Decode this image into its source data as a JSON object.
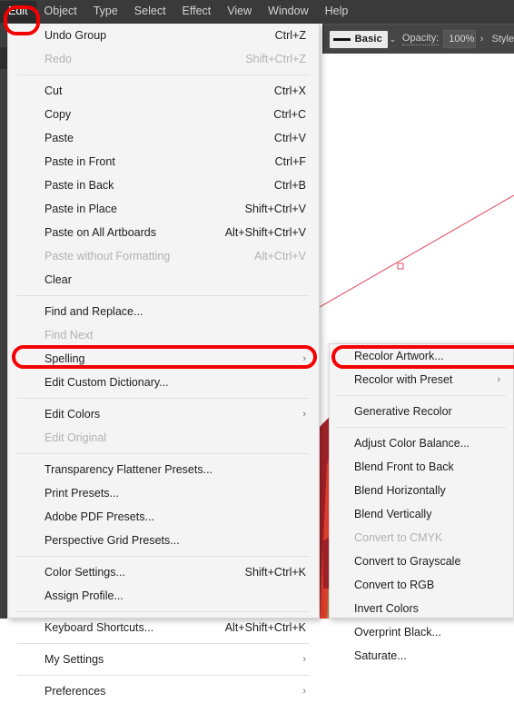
{
  "app": {
    "name": "Adobe Illustrator"
  },
  "menubar": {
    "items": [
      {
        "label": "Edit",
        "active": true
      },
      {
        "label": "Object",
        "active": false
      },
      {
        "label": "Type",
        "active": false
      },
      {
        "label": "Select",
        "active": false
      },
      {
        "label": "Effect",
        "active": false
      },
      {
        "label": "View",
        "active": false
      },
      {
        "label": "Window",
        "active": false
      },
      {
        "label": "Help",
        "active": false
      }
    ]
  },
  "control_bar": {
    "stroke_profile_label": "Basic",
    "opacity_label": "Opacity:",
    "opacity_value": "100%",
    "style_label": "Style",
    "caret_glyph": "⌄",
    "arrow_glyph": "›"
  },
  "edit_menu": {
    "groups": [
      {
        "items": [
          {
            "label": "Undo Group",
            "shortcut": "Ctrl+Z",
            "disabled": false,
            "submenu": false
          },
          {
            "label": "Redo",
            "shortcut": "Shift+Ctrl+Z",
            "disabled": true,
            "submenu": false
          }
        ]
      },
      {
        "items": [
          {
            "label": "Cut",
            "shortcut": "Ctrl+X",
            "disabled": false,
            "submenu": false
          },
          {
            "label": "Copy",
            "shortcut": "Ctrl+C",
            "disabled": false,
            "submenu": false
          },
          {
            "label": "Paste",
            "shortcut": "Ctrl+V",
            "disabled": false,
            "submenu": false
          },
          {
            "label": "Paste in Front",
            "shortcut": "Ctrl+F",
            "disabled": false,
            "submenu": false
          },
          {
            "label": "Paste in Back",
            "shortcut": "Ctrl+B",
            "disabled": false,
            "submenu": false
          },
          {
            "label": "Paste in Place",
            "shortcut": "Shift+Ctrl+V",
            "disabled": false,
            "submenu": false
          },
          {
            "label": "Paste on All Artboards",
            "shortcut": "Alt+Shift+Ctrl+V",
            "disabled": false,
            "submenu": false
          },
          {
            "label": "Paste without Formatting",
            "shortcut": "Alt+Ctrl+V",
            "disabled": true,
            "submenu": false
          },
          {
            "label": "Clear",
            "shortcut": "",
            "disabled": false,
            "submenu": false
          }
        ]
      },
      {
        "items": [
          {
            "label": "Find and Replace...",
            "shortcut": "",
            "disabled": false,
            "submenu": false
          },
          {
            "label": "Find Next",
            "shortcut": "",
            "disabled": true,
            "submenu": false
          },
          {
            "label": "Spelling",
            "shortcut": "",
            "disabled": false,
            "submenu": true
          },
          {
            "label": "Edit Custom Dictionary...",
            "shortcut": "",
            "disabled": false,
            "submenu": false
          }
        ]
      },
      {
        "items": [
          {
            "label": "Edit Colors",
            "shortcut": "",
            "disabled": false,
            "submenu": true,
            "highlighted": true
          },
          {
            "label": "Edit Original",
            "shortcut": "",
            "disabled": true,
            "submenu": false
          }
        ]
      },
      {
        "items": [
          {
            "label": "Transparency Flattener Presets...",
            "shortcut": "",
            "disabled": false,
            "submenu": false
          },
          {
            "label": "Print Presets...",
            "shortcut": "",
            "disabled": false,
            "submenu": false
          },
          {
            "label": "Adobe PDF Presets...",
            "shortcut": "",
            "disabled": false,
            "submenu": false
          },
          {
            "label": "Perspective Grid Presets...",
            "shortcut": "",
            "disabled": false,
            "submenu": false
          }
        ]
      },
      {
        "items": [
          {
            "label": "Color Settings...",
            "shortcut": "Shift+Ctrl+K",
            "disabled": false,
            "submenu": false
          },
          {
            "label": "Assign Profile...",
            "shortcut": "",
            "disabled": false,
            "submenu": false
          }
        ]
      },
      {
        "items": [
          {
            "label": "Keyboard Shortcuts...",
            "shortcut": "Alt+Shift+Ctrl+K",
            "disabled": false,
            "submenu": false
          }
        ]
      },
      {
        "items": [
          {
            "label": "My Settings",
            "shortcut": "",
            "disabled": false,
            "submenu": true
          }
        ]
      },
      {
        "items": [
          {
            "label": "Preferences",
            "shortcut": "",
            "disabled": false,
            "submenu": true
          }
        ]
      }
    ]
  },
  "edit_colors_submenu": {
    "groups": [
      {
        "items": [
          {
            "label": "Recolor Artwork...",
            "shortcut": "",
            "disabled": false,
            "submenu": false,
            "highlighted": true
          },
          {
            "label": "Recolor with Preset",
            "shortcut": "",
            "disabled": false,
            "submenu": true
          }
        ]
      },
      {
        "items": [
          {
            "label": "Generative Recolor",
            "shortcut": "",
            "disabled": false,
            "submenu": false
          }
        ]
      },
      {
        "items": [
          {
            "label": "Adjust Color Balance...",
            "shortcut": "",
            "disabled": false,
            "submenu": false
          },
          {
            "label": "Blend Front to Back",
            "shortcut": "",
            "disabled": false,
            "submenu": false
          },
          {
            "label": "Blend Horizontally",
            "shortcut": "",
            "disabled": false,
            "submenu": false
          },
          {
            "label": "Blend Vertically",
            "shortcut": "",
            "disabled": false,
            "submenu": false
          },
          {
            "label": "Convert to CMYK",
            "shortcut": "",
            "disabled": true,
            "submenu": false
          },
          {
            "label": "Convert to Grayscale",
            "shortcut": "",
            "disabled": false,
            "submenu": false
          },
          {
            "label": "Convert to RGB",
            "shortcut": "",
            "disabled": false,
            "submenu": false
          },
          {
            "label": "Invert Colors",
            "shortcut": "",
            "disabled": false,
            "submenu": false
          },
          {
            "label": "Overprint Black...",
            "shortcut": "",
            "disabled": false,
            "submenu": false
          },
          {
            "label": "Saturate...",
            "shortcut": "",
            "disabled": false,
            "submenu": false
          }
        ]
      }
    ]
  },
  "annotations": [
    {
      "name": "edit-menubar-highlight",
      "shape": "oval",
      "color": "#f50000"
    },
    {
      "name": "edit-colors-highlight",
      "shape": "rounded-rect",
      "color": "#f50000"
    },
    {
      "name": "recolor-artwork-highlight",
      "shape": "rounded-rect",
      "color": "#f50000"
    }
  ],
  "artwork": {
    "description": "vector illustration of green and red organic shapes with selection path",
    "colors": {
      "green_light": "#8dc97d",
      "green_mid": "#7ab869",
      "red_bright": "#e8412f",
      "red_dark": "#a6232a",
      "red_mid": "#c93e30",
      "selection_path": "#e2536a"
    }
  }
}
